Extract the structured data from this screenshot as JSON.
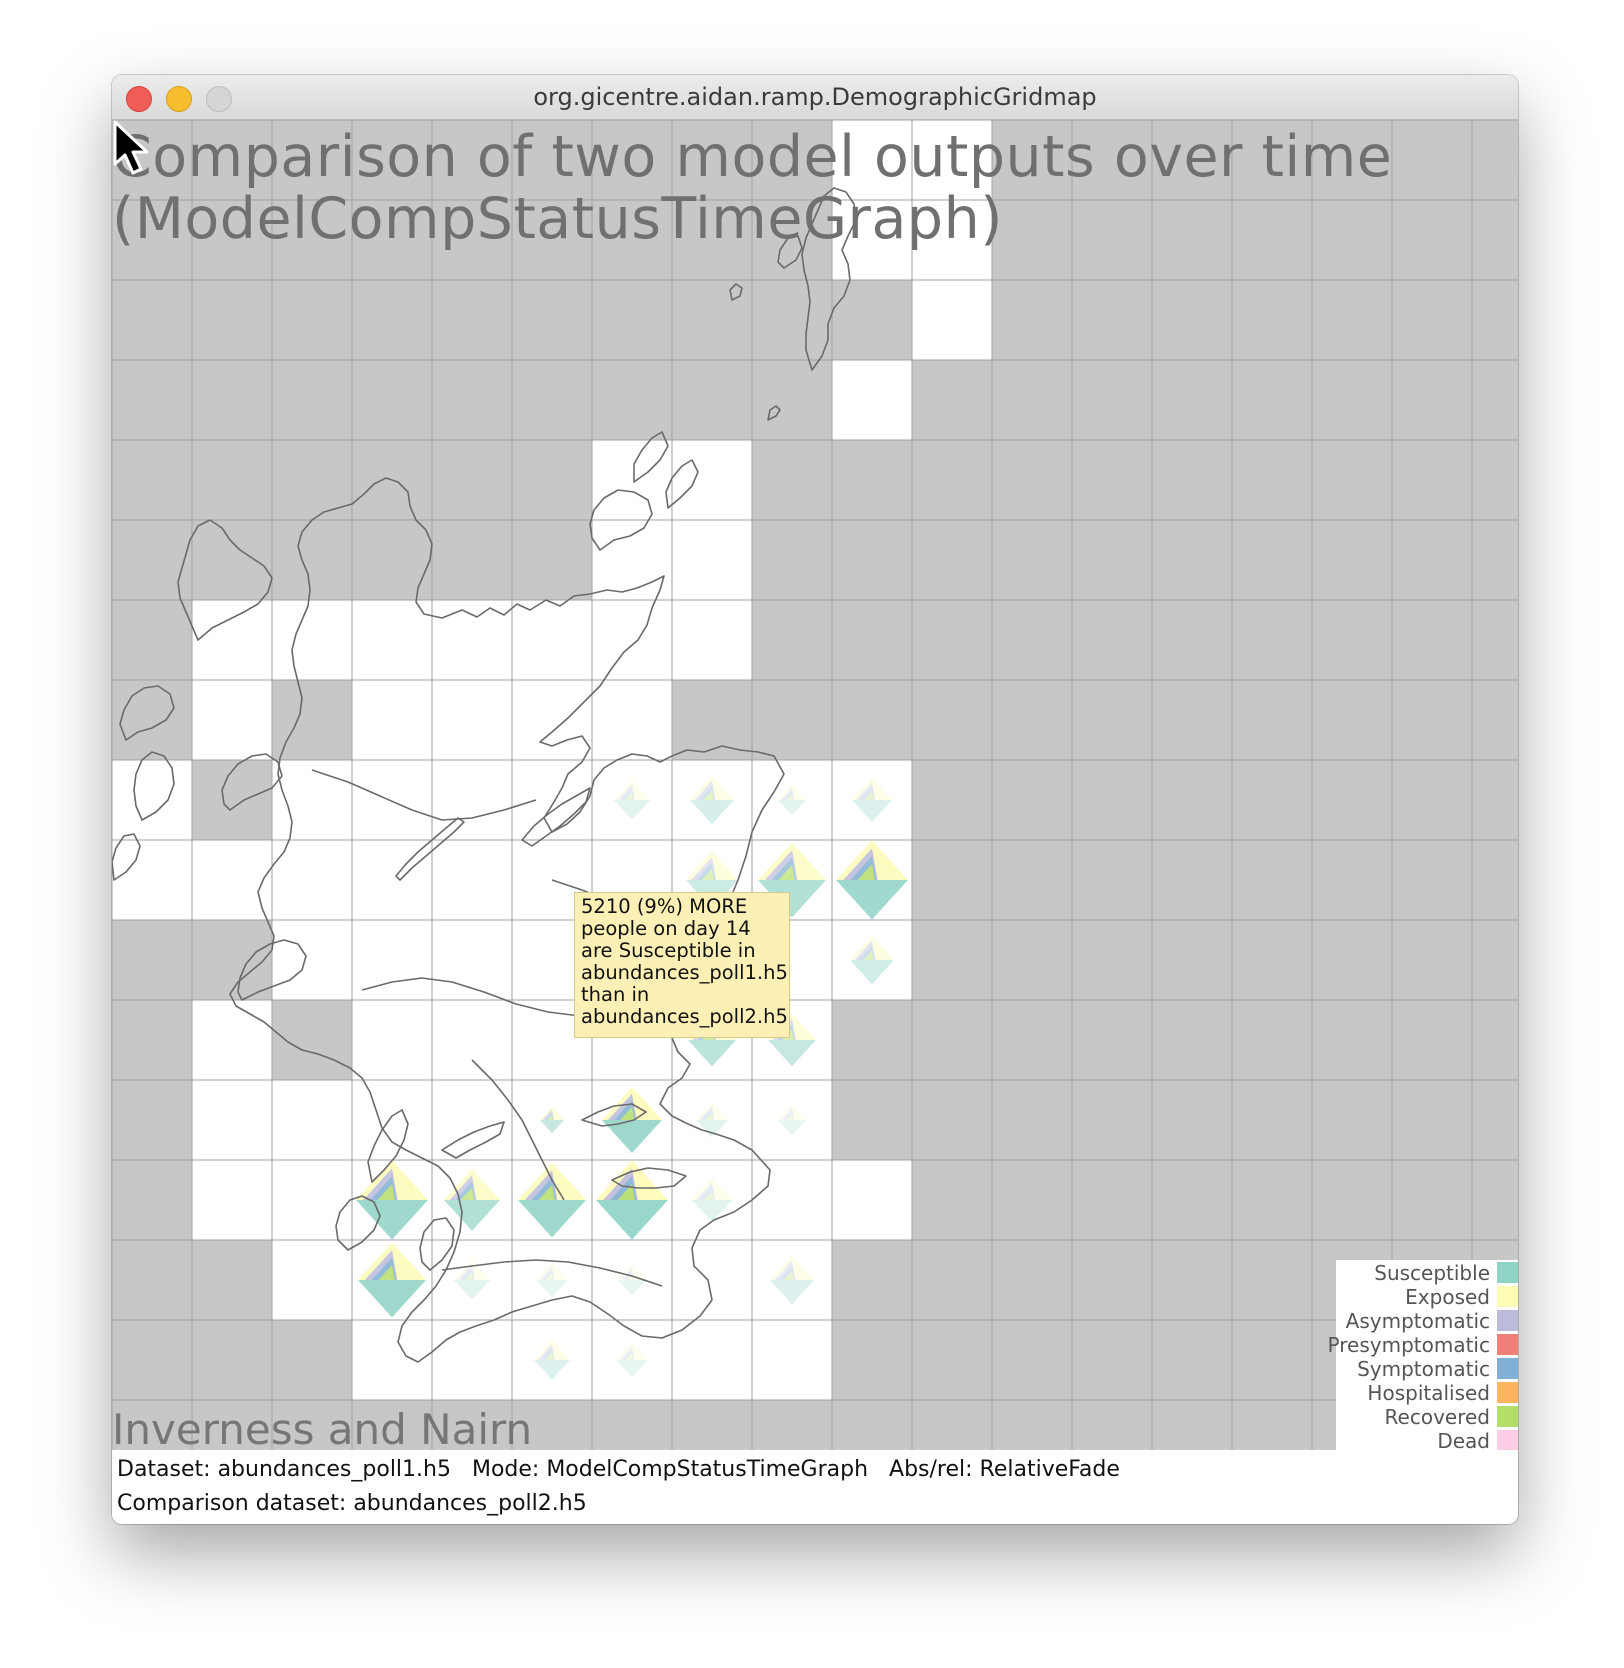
{
  "window": {
    "title": "org.gicentre.aidan.ramp.DemographicGridmap"
  },
  "view": {
    "heading_line1": "Comparison of two model outputs over time",
    "heading_line2": "(ModelCompStatusTimeGraph)",
    "selected_area": "Inverness and Nairn"
  },
  "tooltip": {
    "lines": [
      "5210 (9%) MORE",
      "people on day 14",
      "are Susceptible in",
      "abundances_poll1.h5",
      "than in",
      "abundances_poll2.h5"
    ]
  },
  "legend": {
    "items": [
      {
        "label": "Susceptible",
        "color": "#8fd3c5"
      },
      {
        "label": "Exposed",
        "color": "#fdfcb6"
      },
      {
        "label": "Asymptomatic",
        "color": "#bdbbdb"
      },
      {
        "label": "Presymptomatic",
        "color": "#f08077"
      },
      {
        "label": "Symptomatic",
        "color": "#80b0d4"
      },
      {
        "label": "Hospitalised",
        "color": "#fcb462"
      },
      {
        "label": "Recovered",
        "color": "#b3de69"
      },
      {
        "label": "Dead",
        "color": "#fccde5"
      }
    ]
  },
  "status": {
    "dataset_label": "Dataset:",
    "dataset_value": "abundances_poll1.h5",
    "mode_label": "Mode:",
    "mode_value": "ModelCompStatusTimeGraph",
    "absrel_label": "Abs/rel:",
    "absrel_value": "RelativeFade",
    "comparison_label": "Comparison dataset:",
    "comparison_value": "abundances_poll2.h5"
  },
  "colors": {
    "grid_background": "#c7c7c7",
    "occupied_cell": "#ffffff",
    "grid_line": "#a2a2a2",
    "coastline": "#6a6a6a",
    "tooltip_background": "#fdf0b6"
  }
}
